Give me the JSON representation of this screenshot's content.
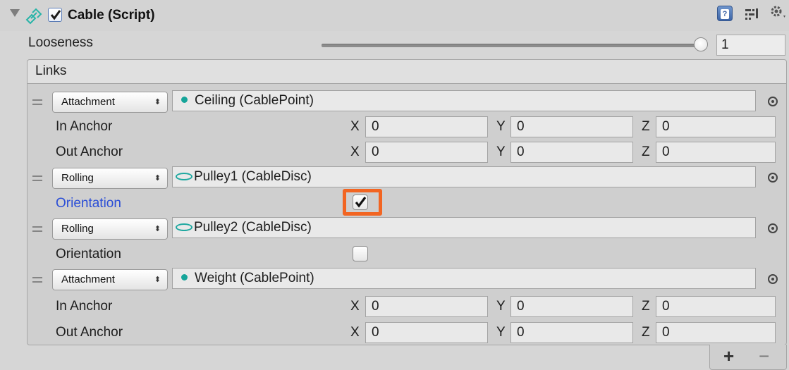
{
  "header": {
    "title": "Cable (Script)",
    "enabled": true,
    "help_glyph": "?"
  },
  "looseness": {
    "label": "Looseness",
    "value": "1",
    "slider_fraction": 1.0
  },
  "links": {
    "title": "Links",
    "items": [
      {
        "type": "Attachment",
        "object": "Ceiling (CablePoint)",
        "object_icon": "cable-point-dot-icon",
        "in_anchor": {
          "label": "In Anchor",
          "x": "0",
          "y": "0",
          "z": "0"
        },
        "out_anchor": {
          "label": "Out Anchor",
          "x": "0",
          "y": "0",
          "z": "0"
        }
      },
      {
        "type": "Rolling",
        "object": "Pulley1 (CableDisc)",
        "object_icon": "cable-disc-icon",
        "orientation": {
          "label": "Orientation",
          "checked": true
        }
      },
      {
        "type": "Rolling",
        "object": "Pulley2 (CableDisc)",
        "object_icon": "cable-disc-icon",
        "orientation": {
          "label": "Orientation",
          "checked": false
        }
      },
      {
        "type": "Attachment",
        "object": "Weight (CablePoint)",
        "object_icon": "cable-point-dot-icon",
        "in_anchor": {
          "label": "In Anchor",
          "x": "0",
          "y": "0",
          "z": "0"
        },
        "out_anchor": {
          "label": "Out Anchor",
          "x": "0",
          "y": "0",
          "z": "0"
        }
      }
    ],
    "axis_labels": {
      "x": "X",
      "y": "Y",
      "z": "Z"
    },
    "add_label": "+",
    "remove_label": "−"
  },
  "colors": {
    "highlight": "#f26522",
    "modified_label": "#2c4fd6",
    "object_icon": "#16a59a"
  }
}
